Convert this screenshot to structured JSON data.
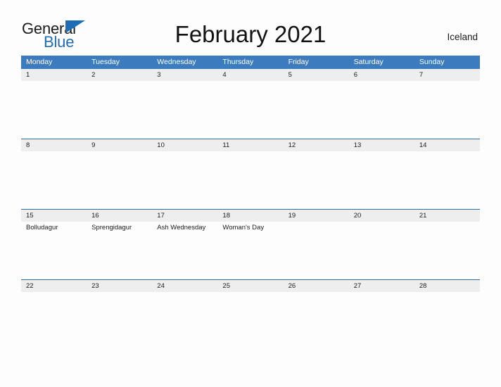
{
  "brand": {
    "name_part1": "General",
    "name_part2": "Blue",
    "triangle_color": "#1f6eb5"
  },
  "header": {
    "title": "February 2021",
    "region": "Iceland",
    "header_bar_color": "#3c7cbe",
    "row_divider_color": "#2f6ca6",
    "date_band_color": "#eeeeee"
  },
  "weekdays": [
    "Monday",
    "Tuesday",
    "Wednesday",
    "Thursday",
    "Friday",
    "Saturday",
    "Sunday"
  ],
  "weeks": [
    {
      "days": [
        {
          "date": "1",
          "event": ""
        },
        {
          "date": "2",
          "event": ""
        },
        {
          "date": "3",
          "event": ""
        },
        {
          "date": "4",
          "event": ""
        },
        {
          "date": "5",
          "event": ""
        },
        {
          "date": "6",
          "event": ""
        },
        {
          "date": "7",
          "event": ""
        }
      ]
    },
    {
      "days": [
        {
          "date": "8",
          "event": ""
        },
        {
          "date": "9",
          "event": ""
        },
        {
          "date": "10",
          "event": ""
        },
        {
          "date": "11",
          "event": ""
        },
        {
          "date": "12",
          "event": ""
        },
        {
          "date": "13",
          "event": ""
        },
        {
          "date": "14",
          "event": ""
        }
      ]
    },
    {
      "days": [
        {
          "date": "15",
          "event": "Bolludagur"
        },
        {
          "date": "16",
          "event": "Sprengidagur"
        },
        {
          "date": "17",
          "event": "Ash Wednesday"
        },
        {
          "date": "18",
          "event": "Woman's Day"
        },
        {
          "date": "19",
          "event": ""
        },
        {
          "date": "20",
          "event": ""
        },
        {
          "date": "21",
          "event": ""
        }
      ]
    },
    {
      "days": [
        {
          "date": "22",
          "event": ""
        },
        {
          "date": "23",
          "event": ""
        },
        {
          "date": "24",
          "event": ""
        },
        {
          "date": "25",
          "event": ""
        },
        {
          "date": "26",
          "event": ""
        },
        {
          "date": "27",
          "event": ""
        },
        {
          "date": "28",
          "event": ""
        }
      ]
    }
  ]
}
